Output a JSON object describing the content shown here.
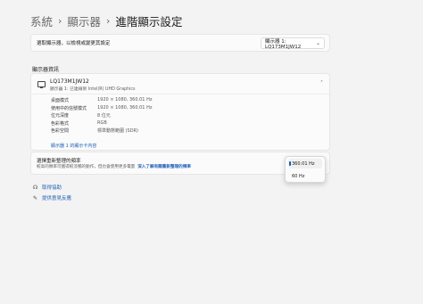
{
  "breadcrumb": {
    "items": [
      "系統",
      "顯示器"
    ],
    "current": "進階顯示設定",
    "separator": "›"
  },
  "display_select": {
    "label": "選取顯示器，以檢視或變更其設定",
    "value": "顯示器 1: LQ173M1JW12"
  },
  "section_title": "顯示器資訊",
  "monitor": {
    "name": "LQ173M1JW12",
    "subtitle": "顯示器 1: 已連線到 Intel(R) UHD Graphics",
    "properties": [
      {
        "key": "桌面模式",
        "value": "1920 × 1080, 360.01 Hz"
      },
      {
        "key": "使用中的信號模式",
        "value": "1920 × 1080, 360.01 Hz"
      },
      {
        "key": "位元深度",
        "value": "8 位元"
      },
      {
        "key": "色彩格式",
        "value": "RGB"
      },
      {
        "key": "色彩空間",
        "value": "標準動態範圍 (SDR)"
      }
    ],
    "adapter_link": "顯示器 1 的顯示卡內容"
  },
  "refresh_rate": {
    "title": "選擇重新整理的頻率",
    "description": "較高的頻率可獲得較流暢的動作，但也會使用更多電量",
    "learn_more": "深入了解有關重新整理的頻率",
    "options": [
      "360.01 Hz",
      "60 Hz"
    ],
    "selected": "360.01 Hz"
  },
  "footer": {
    "get_help": "取得協助",
    "feedback": "提供意見反應"
  },
  "colors": {
    "accent": "#005fb8",
    "link": "#1f5fb8",
    "background": "#f3f3f3",
    "card": "#fbfbfb"
  }
}
